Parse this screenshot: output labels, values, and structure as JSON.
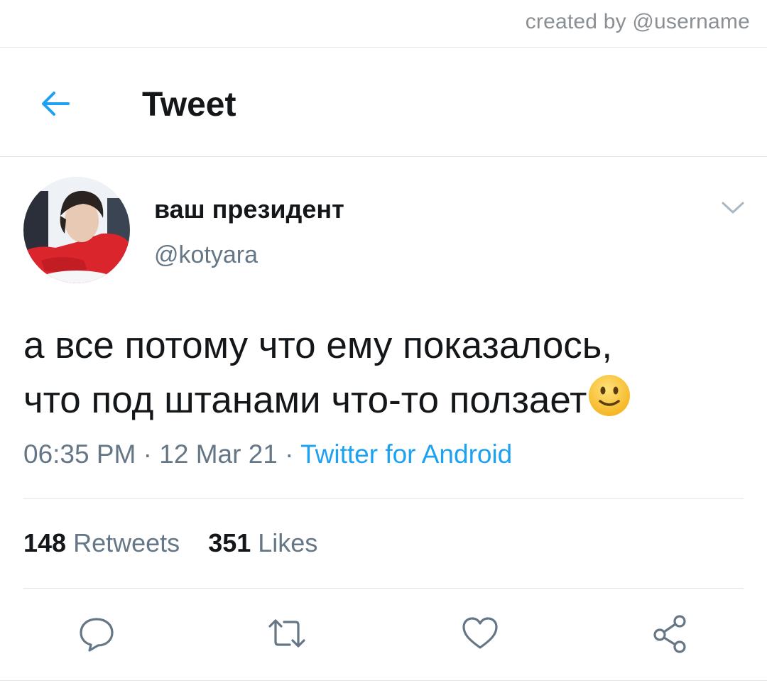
{
  "watermark": "created by @username",
  "header": {
    "title": "Tweet",
    "back_icon": "arrow-left-icon",
    "accent": "#1da1f2"
  },
  "tweet": {
    "author": {
      "name": "ваш президент",
      "handle": "@kotyara"
    },
    "text_line1": "а все потому что ему показалось,",
    "text_line2": "что под штанами что-то ползает",
    "emoji": "slightly-smiling-face-icon",
    "time": "06:35 PM",
    "sep1": " · ",
    "date": "12 Mar 21",
    "sep2": " · ",
    "source": "Twitter for Android",
    "stats": {
      "retweets_count": "148",
      "retweets_label": "Retweets",
      "likes_count": "351",
      "likes_label": "Likes"
    }
  },
  "actions": [
    "reply-icon",
    "retweet-icon",
    "like-icon",
    "share-icon"
  ],
  "colors": {
    "text": "#14171a",
    "secondary": "#657786",
    "link": "#1da1f2",
    "divider": "#e1e5e8"
  }
}
